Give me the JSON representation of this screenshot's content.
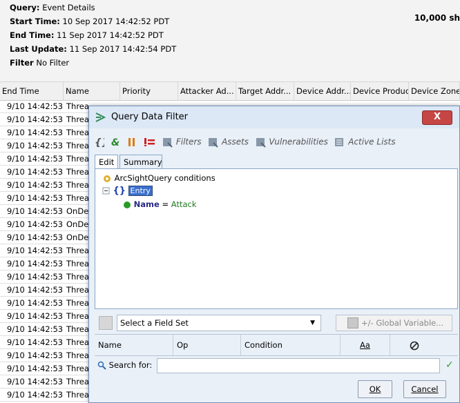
{
  "header": {
    "query_label": "Query:",
    "query_value": "Event Details",
    "start_label": "Start Time:",
    "start_value": "10 Sep 2017 14:42:52 PDT",
    "end_label": "End Time:",
    "end_value": "11 Sep 2017 14:42:52 PDT",
    "update_label": "Last Update:",
    "update_value": "11 Sep 2017 14:42:54 PDT",
    "filter_label": "Filter",
    "filter_value": "No Filter",
    "count": "10,000 sh"
  },
  "grid": {
    "columns": [
      "End Time",
      "Name",
      "Priority",
      "Attacker Ad...",
      "Target Addr...",
      "Device Addr...",
      "Device Product",
      "Device Zone..."
    ],
    "rows": [
      {
        "time": "9/10 14:42:53",
        "name": "Threa"
      },
      {
        "time": "9/10 14:42:53",
        "name": "Threa"
      },
      {
        "time": "9/10 14:42:53",
        "name": "Threa"
      },
      {
        "time": "9/10 14:42:53",
        "name": "Threa"
      },
      {
        "time": "9/10 14:42:53",
        "name": "Threa"
      },
      {
        "time": "9/10 14:42:53",
        "name": "Threa"
      },
      {
        "time": "9/10 14:42:53",
        "name": "Threa"
      },
      {
        "time": "9/10 14:42:53",
        "name": "Threa"
      },
      {
        "time": "9/10 14:42:53",
        "name": "OnDe"
      },
      {
        "time": "9/10 14:42:53",
        "name": "OnDe"
      },
      {
        "time": "9/10 14:42:53",
        "name": "OnDe"
      },
      {
        "time": "9/10 14:42:53",
        "name": "Threa"
      },
      {
        "time": "9/10 14:42:53",
        "name": "Threa"
      },
      {
        "time": "9/10 14:42:53",
        "name": "Threa"
      },
      {
        "time": "9/10 14:42:53",
        "name": "Threa"
      },
      {
        "time": "9/10 14:42:53",
        "name": "Threa"
      },
      {
        "time": "9/10 14:42:53",
        "name": "Threa"
      },
      {
        "time": "9/10 14:42:53",
        "name": "Threa"
      },
      {
        "time": "9/10 14:42:53",
        "name": "Threa"
      },
      {
        "time": "9/10 14:42:53",
        "name": "Threa"
      },
      {
        "time": "9/10 14:42:53",
        "name": "Threa"
      },
      {
        "time": "9/10 14:42:53",
        "name": "Threa"
      },
      {
        "time": "9/10 14:42:53",
        "name": "Threa"
      },
      {
        "time": "9/10 14:42:53",
        "name": "Threa"
      }
    ]
  },
  "dialog": {
    "title": "Query Data Filter",
    "close": "X",
    "toolbar": {
      "filters": "Filters",
      "assets": "Assets",
      "vulnerabilities": "Vulnerabilities",
      "active_lists": "Active Lists"
    },
    "tabs": [
      "Edit",
      "Summary"
    ],
    "tree": {
      "root": "ArcSightQuery conditions",
      "entry": "Entry",
      "cond_name": "Name",
      "cond_op": "=",
      "cond_value": "Attack"
    },
    "fieldset": {
      "value": "Select a Field Set",
      "global_var": "+/- Global Variable..."
    },
    "table_headers": {
      "name": "Name",
      "op": "Op",
      "condition": "Condition",
      "case": "Aa"
    },
    "search_label": "Search for:",
    "search_value": "",
    "ok": "OK",
    "cancel": "Cancel"
  },
  "colors": {
    "dialog_bg": "#e9f0f8",
    "close_red": "#c64545",
    "selection": "#3a6fcf"
  }
}
